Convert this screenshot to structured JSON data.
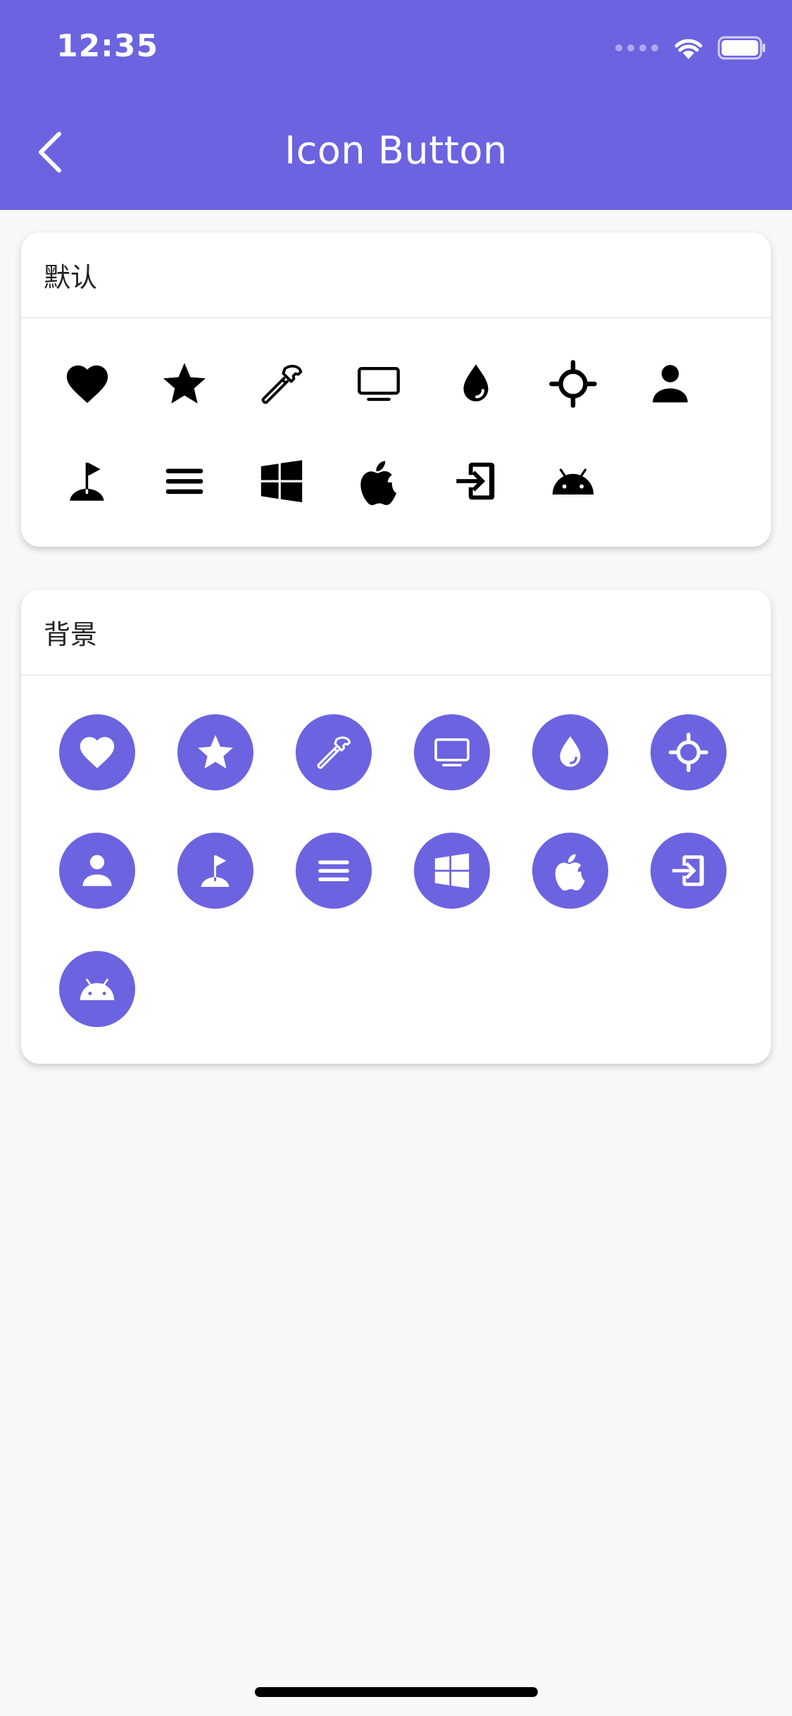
{
  "status": {
    "time": "12:35"
  },
  "appbar": {
    "title": "Icon Button"
  },
  "colors": {
    "accent": "#6c63e0",
    "icon_default": "#000000",
    "icon_on_accent": "#ffffff"
  },
  "sections": [
    {
      "label": "默认",
      "style": "plain",
      "icons": [
        "heart-icon",
        "star-icon",
        "hammer-icon",
        "monitor-icon",
        "water-drop-icon",
        "crosshair-icon",
        "person-icon",
        "golf-flag-icon",
        "menu-icon",
        "windows-icon",
        "apple-icon",
        "login-icon",
        "android-icon"
      ]
    },
    {
      "label": "背景",
      "style": "circle",
      "icons": [
        "heart-icon",
        "star-icon",
        "hammer-icon",
        "monitor-icon",
        "water-drop-icon",
        "crosshair-icon",
        "person-icon",
        "golf-flag-icon",
        "menu-icon",
        "windows-icon",
        "apple-icon",
        "login-icon",
        "android-icon"
      ]
    }
  ]
}
